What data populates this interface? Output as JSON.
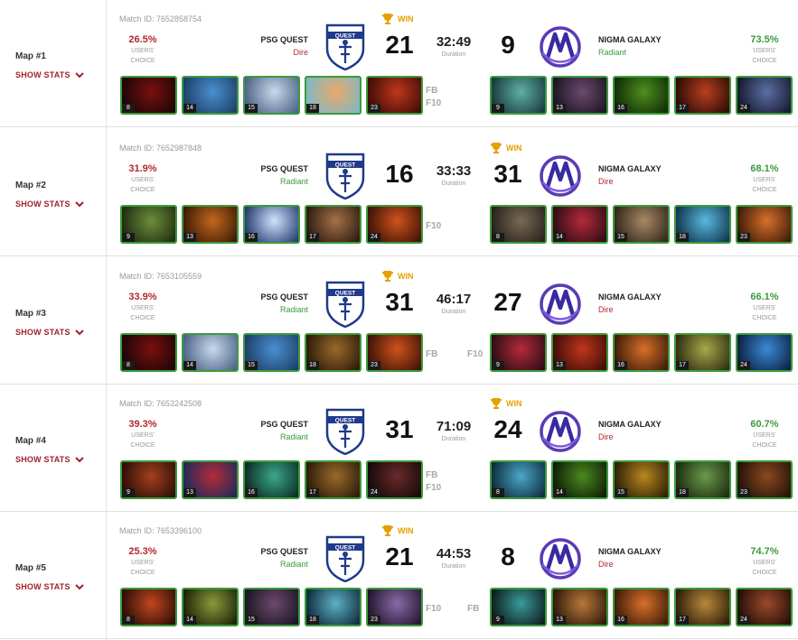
{
  "common": {
    "show_stats": "SHOW STATS",
    "users_choice_line1": "USERS'",
    "users_choice_line2": "CHOICE",
    "duration_label": "Duration",
    "win_label": "WIN",
    "team_left": "PSG QUEST",
    "team_right": "NIGMA GALAXY",
    "colors": {
      "win_gold": "#e5a100",
      "dire_red": "#b0282f",
      "radiant_green": "#3b9a3e",
      "hero_border": "#3d9a3d"
    }
  },
  "maps": [
    {
      "label": "Map #1",
      "match_id": "Match ID: 7652858754",
      "left_pct": "26.5%",
      "left_side": "Dire",
      "left_score": "21",
      "duration": "32:49",
      "right_score": "9",
      "right_side": "Radiant",
      "right_pct": "73.5%",
      "winner": "left",
      "left_tags": [
        "FB",
        "F10"
      ],
      "right_tags": [],
      "left_heroes": [
        {
          "num": "8",
          "c1": "#7a1010",
          "c2": "#1a0505"
        },
        {
          "num": "14",
          "c1": "#4a8fd0",
          "c2": "#1c3f66"
        },
        {
          "num": "15",
          "c1": "#c9d9ec",
          "c2": "#4a6285"
        },
        {
          "num": "18",
          "c1": "#e8a869",
          "c2": "#7fb8c7"
        },
        {
          "num": "23",
          "c1": "#c0361d",
          "c2": "#3d0c06"
        }
      ],
      "right_heroes": [
        {
          "num": "9",
          "c1": "#5fb0a6",
          "c2": "#17393b"
        },
        {
          "num": "13",
          "c1": "#6b4a6e",
          "c2": "#1a1320"
        },
        {
          "num": "16",
          "c1": "#4f8f1e",
          "c2": "#0f2a06"
        },
        {
          "num": "17",
          "c1": "#b8401e",
          "c2": "#2a0a05"
        },
        {
          "num": "24",
          "c1": "#5c6fa5",
          "c2": "#14182c"
        }
      ]
    },
    {
      "label": "Map #2",
      "match_id": "Match ID: 7652987848",
      "left_pct": "31.9%",
      "left_side": "Radiant",
      "left_score": "16",
      "duration": "33:33",
      "right_score": "31",
      "right_side": "Dire",
      "right_pct": "68.1%",
      "winner": "right",
      "left_tags": [
        "F10"
      ],
      "right_tags": [],
      "left_heroes": [
        {
          "num": "9",
          "c1": "#6b8f3a",
          "c2": "#1f2b10"
        },
        {
          "num": "13",
          "c1": "#c2681c",
          "c2": "#3a1a06"
        },
        {
          "num": "16",
          "c1": "#cfe3ff",
          "c2": "#223a6e"
        },
        {
          "num": "17",
          "c1": "#a57148",
          "c2": "#2a1a10"
        },
        {
          "num": "24",
          "c1": "#d0521c",
          "c2": "#3a1206"
        }
      ],
      "right_heroes": [
        {
          "num": "8",
          "c1": "#7a6a55",
          "c2": "#26201a"
        },
        {
          "num": "14",
          "c1": "#b52a3a",
          "c2": "#2a0c14"
        },
        {
          "num": "15",
          "c1": "#a88a66",
          "c2": "#2f2518"
        },
        {
          "num": "18",
          "c1": "#58b8e0",
          "c2": "#10344a"
        },
        {
          "num": "23",
          "c1": "#d8702a",
          "c2": "#3a1a08"
        }
      ]
    },
    {
      "label": "Map #3",
      "match_id": "Match ID: 7653105559",
      "left_pct": "33.9%",
      "left_side": "Radiant",
      "left_score": "31",
      "duration": "46:17",
      "right_score": "27",
      "right_side": "Dire",
      "right_pct": "66.1%",
      "winner": "left",
      "left_tags": [
        "FB"
      ],
      "right_tags": [
        "F10"
      ],
      "left_heroes": [
        {
          "num": "8",
          "c1": "#7a1010",
          "c2": "#1a0505"
        },
        {
          "num": "14",
          "c1": "#c9d9ec",
          "c2": "#4a6285"
        },
        {
          "num": "15",
          "c1": "#4a8fd0",
          "c2": "#1c3f66"
        },
        {
          "num": "18",
          "c1": "#9a6a2a",
          "c2": "#2a1a08"
        },
        {
          "num": "23",
          "c1": "#d0521c",
          "c2": "#3a1206"
        }
      ],
      "right_heroes": [
        {
          "num": "9",
          "c1": "#b52a3a",
          "c2": "#2a0c14"
        },
        {
          "num": "13",
          "c1": "#c0361d",
          "c2": "#3d0c06"
        },
        {
          "num": "16",
          "c1": "#d8702a",
          "c2": "#3a1a08"
        },
        {
          "num": "17",
          "c1": "#a8a84a",
          "c2": "#2c2c10"
        },
        {
          "num": "24",
          "c1": "#3a8ad8",
          "c2": "#0c2040"
        }
      ]
    },
    {
      "label": "Map #4",
      "match_id": "Match ID: 7653242508",
      "left_pct": "39.3%",
      "left_side": "Radiant",
      "left_score": "31",
      "duration": "71:09",
      "right_score": "24",
      "right_side": "Dire",
      "right_pct": "60.7%",
      "winner": "right",
      "left_tags": [
        "FB",
        "F10"
      ],
      "right_tags": [],
      "left_heroes": [
        {
          "num": "9",
          "c1": "#a3401e",
          "c2": "#2a0c06"
        },
        {
          "num": "13",
          "c1": "#b52a3a",
          "c2": "#1c2a5a"
        },
        {
          "num": "16",
          "c1": "#3aa88a",
          "c2": "#0c2a22"
        },
        {
          "num": "17",
          "c1": "#9a6a2a",
          "c2": "#2a1a08"
        },
        {
          "num": "24",
          "c1": "#6a2a2a",
          "c2": "#140808"
        }
      ],
      "right_heroes": [
        {
          "num": "8",
          "c1": "#4aa8c8",
          "c2": "#0c2a3a"
        },
        {
          "num": "14",
          "c1": "#4a8a1e",
          "c2": "#0c1a06"
        },
        {
          "num": "15",
          "c1": "#b8881e",
          "c2": "#2a1c06"
        },
        {
          "num": "18",
          "c1": "#6a9a4a",
          "c2": "#1a2a10"
        },
        {
          "num": "23",
          "c1": "#8a4a1e",
          "c2": "#201008"
        }
      ]
    },
    {
      "label": "Map #5",
      "match_id": "Match ID: 7653396100",
      "left_pct": "25.3%",
      "left_side": "Radiant",
      "left_score": "21",
      "duration": "44:53",
      "right_score": "8",
      "right_side": "Dire",
      "right_pct": "74.7%",
      "winner": "left",
      "left_tags": [
        "F10"
      ],
      "right_tags": [
        "FB"
      ],
      "left_heroes": [
        {
          "num": "8",
          "c1": "#c0461d",
          "c2": "#2a0c06"
        },
        {
          "num": "14",
          "c1": "#8a9a3a",
          "c2": "#1a2008"
        },
        {
          "num": "15",
          "c1": "#6b4a6e",
          "c2": "#1a1320"
        },
        {
          "num": "18",
          "c1": "#5fb0c6",
          "c2": "#0c2a3a"
        },
        {
          "num": "23",
          "c1": "#8a6aa8",
          "c2": "#20142c"
        }
      ],
      "right_heroes": [
        {
          "num": "9",
          "c1": "#3a9a9a",
          "c2": "#0c1a1a"
        },
        {
          "num": "13",
          "c1": "#b8783a",
          "c2": "#2a1808"
        },
        {
          "num": "16",
          "c1": "#d8702a",
          "c2": "#3a1a08"
        },
        {
          "num": "17",
          "c1": "#b8883a",
          "c2": "#2a1c08"
        },
        {
          "num": "24",
          "c1": "#9a4a2a",
          "c2": "#200c06"
        }
      ]
    }
  ]
}
